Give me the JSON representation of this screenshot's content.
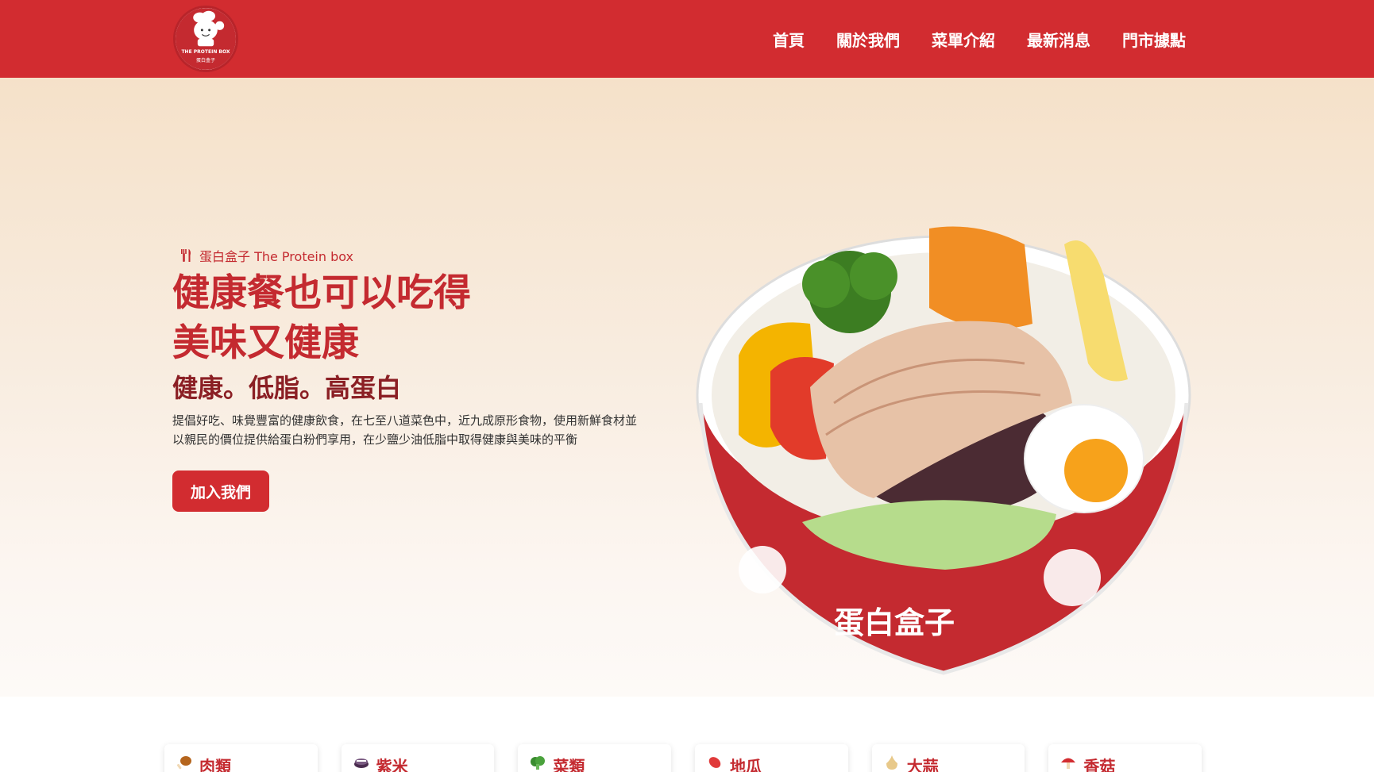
{
  "brand": {
    "logo_text": "THE PROTEIN BOX",
    "logo_sub": "蛋白盒子"
  },
  "nav": {
    "items": [
      "首頁",
      "關於我們",
      "菜單介紹",
      "最新消息",
      "門市據點"
    ]
  },
  "hero": {
    "tagline": "蛋白盒子 The Protein box",
    "headline_1": "健康餐也可以吃得",
    "headline_2": "美味又健康",
    "subhead": "健康。低脂。高蛋白",
    "desc_1": "提倡好吃、味覺豐富的健康飲食，在七至八道菜色中，近九成原形食物，使用新鮮食材並",
    "desc_2": "以親民的價位提供給蛋白粉們享用，在少鹽少油低脂中取得健康與美味的平衡",
    "cta": "加入我們"
  },
  "bowl": {
    "label": "蛋白盒子"
  },
  "categories": [
    {
      "label": "肉類",
      "icon": "meat-icon",
      "color": "#b5651d"
    },
    {
      "label": "紫米",
      "icon": "rice-icon",
      "color": "#4a2c4f"
    },
    {
      "label": "菜類",
      "icon": "vegetable-icon",
      "color": "#3a8c2f"
    },
    {
      "label": "地瓜",
      "icon": "sweet-potato-icon",
      "color": "#e03a3a"
    },
    {
      "label": "大蒜",
      "icon": "garlic-icon",
      "color": "#e8c98a"
    },
    {
      "label": "香菇",
      "icon": "mushroom-icon",
      "color": "#d22c30"
    }
  ],
  "colors": {
    "brand_red": "#d22c30",
    "text_red": "#c42a30",
    "dark_red": "#8b1f24"
  }
}
